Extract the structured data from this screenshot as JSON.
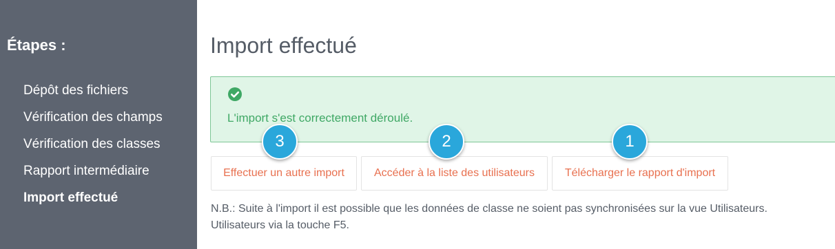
{
  "sidebar": {
    "title": "Étapes :",
    "items": [
      {
        "label": "Dépôt des fichiers"
      },
      {
        "label": "Vérification des champs"
      },
      {
        "label": "Vérification des classes"
      },
      {
        "label": "Rapport intermédiaire"
      },
      {
        "label": "Import effectué"
      }
    ]
  },
  "main": {
    "title": "Import effectué",
    "alert": {
      "icon": "check-circle-icon",
      "message": "L'import s'est correctement déroulé."
    },
    "buttons": {
      "new_import": "Effectuer un autre import",
      "user_list": "Accéder à la liste des utilisateurs",
      "download_report": "Télécharger le rapport d'import"
    },
    "markers": {
      "new_import": "3",
      "user_list": "2",
      "download_report": "1"
    },
    "note": {
      "line1": "N.B.: Suite à l'import il est possible que les données de classe ne soient pas synchronisées sur la vue Utilisateurs.",
      "line2": "Utilisateurs via la touche F5."
    }
  },
  "colors": {
    "sidebar_bg": "#5d6470",
    "alert_bg": "#e0f5e7",
    "success": "#3fa865",
    "button_text": "#e8704f",
    "marker": "#2aa7db"
  }
}
